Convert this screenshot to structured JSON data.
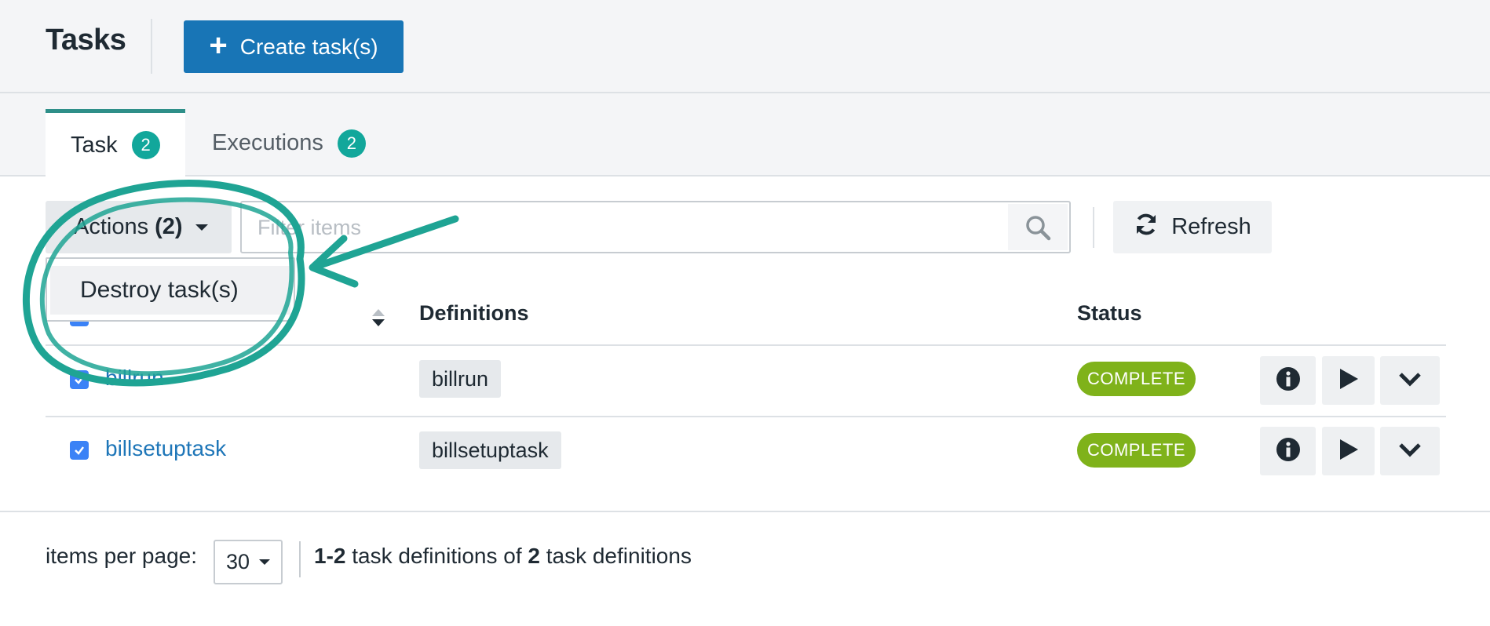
{
  "header": {
    "title": "Tasks",
    "create_label": "Create task(s)"
  },
  "tabs": [
    {
      "label": "Task",
      "count": "2",
      "active": true
    },
    {
      "label": "Executions",
      "count": "2",
      "active": false
    }
  ],
  "toolbar": {
    "actions_label": "Actions",
    "actions_count": "(2)",
    "filter_placeholder": "Filter items",
    "filter_value": "",
    "refresh_label": "Refresh"
  },
  "actions_menu": {
    "items": [
      "Destroy task(s)"
    ]
  },
  "table": {
    "columns": {
      "definitions": "Definitions",
      "status": "Status"
    },
    "rows": [
      {
        "name": "billrun",
        "definition": "billrun",
        "status": "COMPLETE",
        "checked": true
      },
      {
        "name": "billsetuptask",
        "definition": "billsetuptask",
        "status": "COMPLETE",
        "checked": true
      }
    ]
  },
  "footer": {
    "items_per_page_label": "items per page:",
    "items_per_page_value": "30",
    "range": "1-2",
    "range_text": " task definitions of ",
    "total": "2",
    "total_text": " task definitions"
  },
  "colors": {
    "primary": "#1875b6",
    "badge": "#12a79b",
    "status_complete": "#7fb21a",
    "annotation": "#1fa494",
    "link": "#1e76b8"
  },
  "icons": {
    "create": "plus-icon",
    "search": "search-icon",
    "refresh": "refresh-icon",
    "row_actions": [
      "info-icon",
      "play-icon",
      "chevron-down-icon"
    ]
  }
}
